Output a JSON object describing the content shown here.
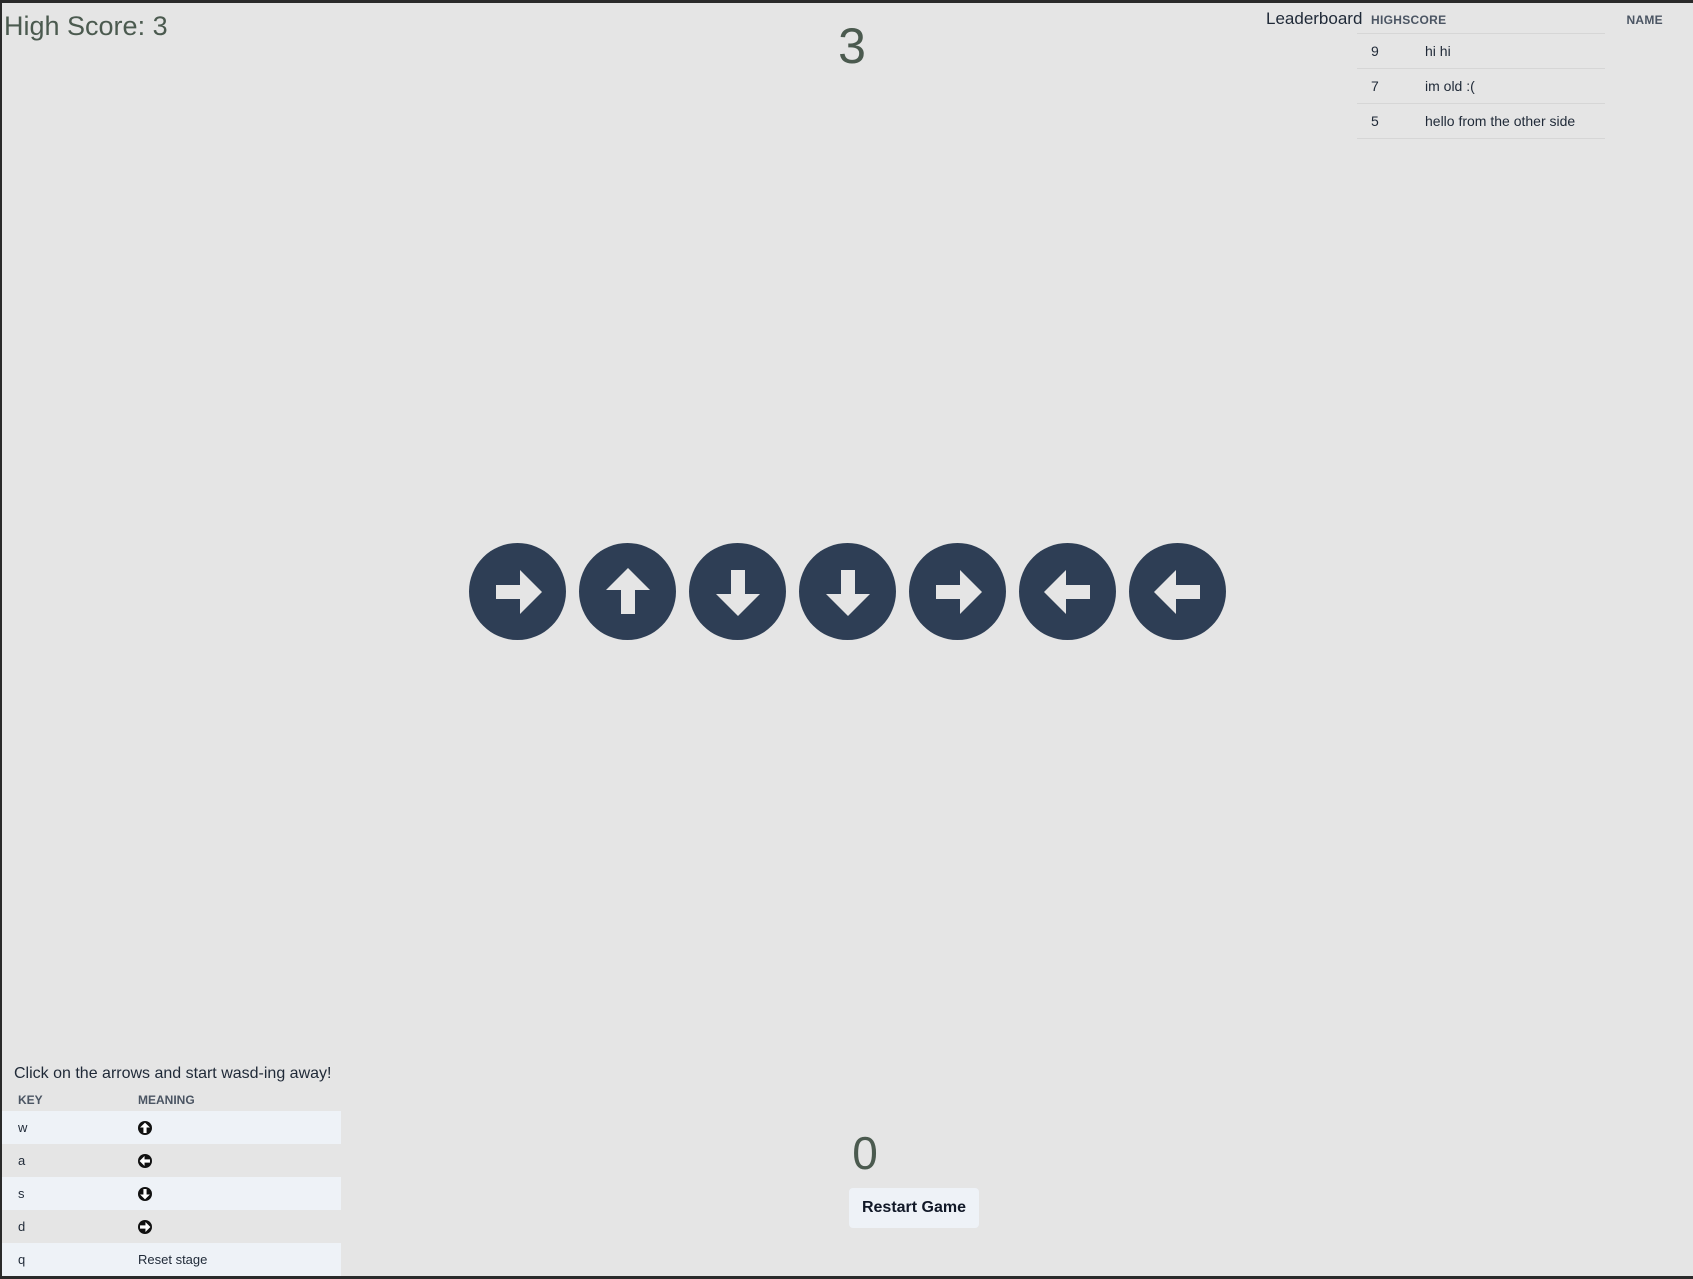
{
  "header": {
    "high_score_text": "High Score: 3",
    "current_score": "3"
  },
  "leaderboard": {
    "label": "Leaderboard",
    "col_highscore": "HIGHSCORE",
    "col_name": "NAME",
    "rows": [
      {
        "score": "9",
        "name": "hi hi"
      },
      {
        "score": "7",
        "name": "im old :("
      },
      {
        "score": "5",
        "name": "hello from the other side"
      }
    ]
  },
  "arrows": [
    "right",
    "up",
    "down",
    "down",
    "right",
    "left",
    "left"
  ],
  "arrow_color": "#2e3e55",
  "arrow_glyph_color": "#e5e5e5",
  "instructions": {
    "text": "Click on the arrows and start wasd-ing away!",
    "col_key": "KEY",
    "col_meaning": "MEANING",
    "rows": [
      {
        "key": "w",
        "meaning_icon": "up"
      },
      {
        "key": "a",
        "meaning_icon": "left"
      },
      {
        "key": "s",
        "meaning_icon": "down"
      },
      {
        "key": "d",
        "meaning_icon": "right"
      },
      {
        "key": "q",
        "meaning_text": "Reset stage"
      }
    ]
  },
  "footer": {
    "score": "0",
    "restart_label": "Restart Game"
  }
}
